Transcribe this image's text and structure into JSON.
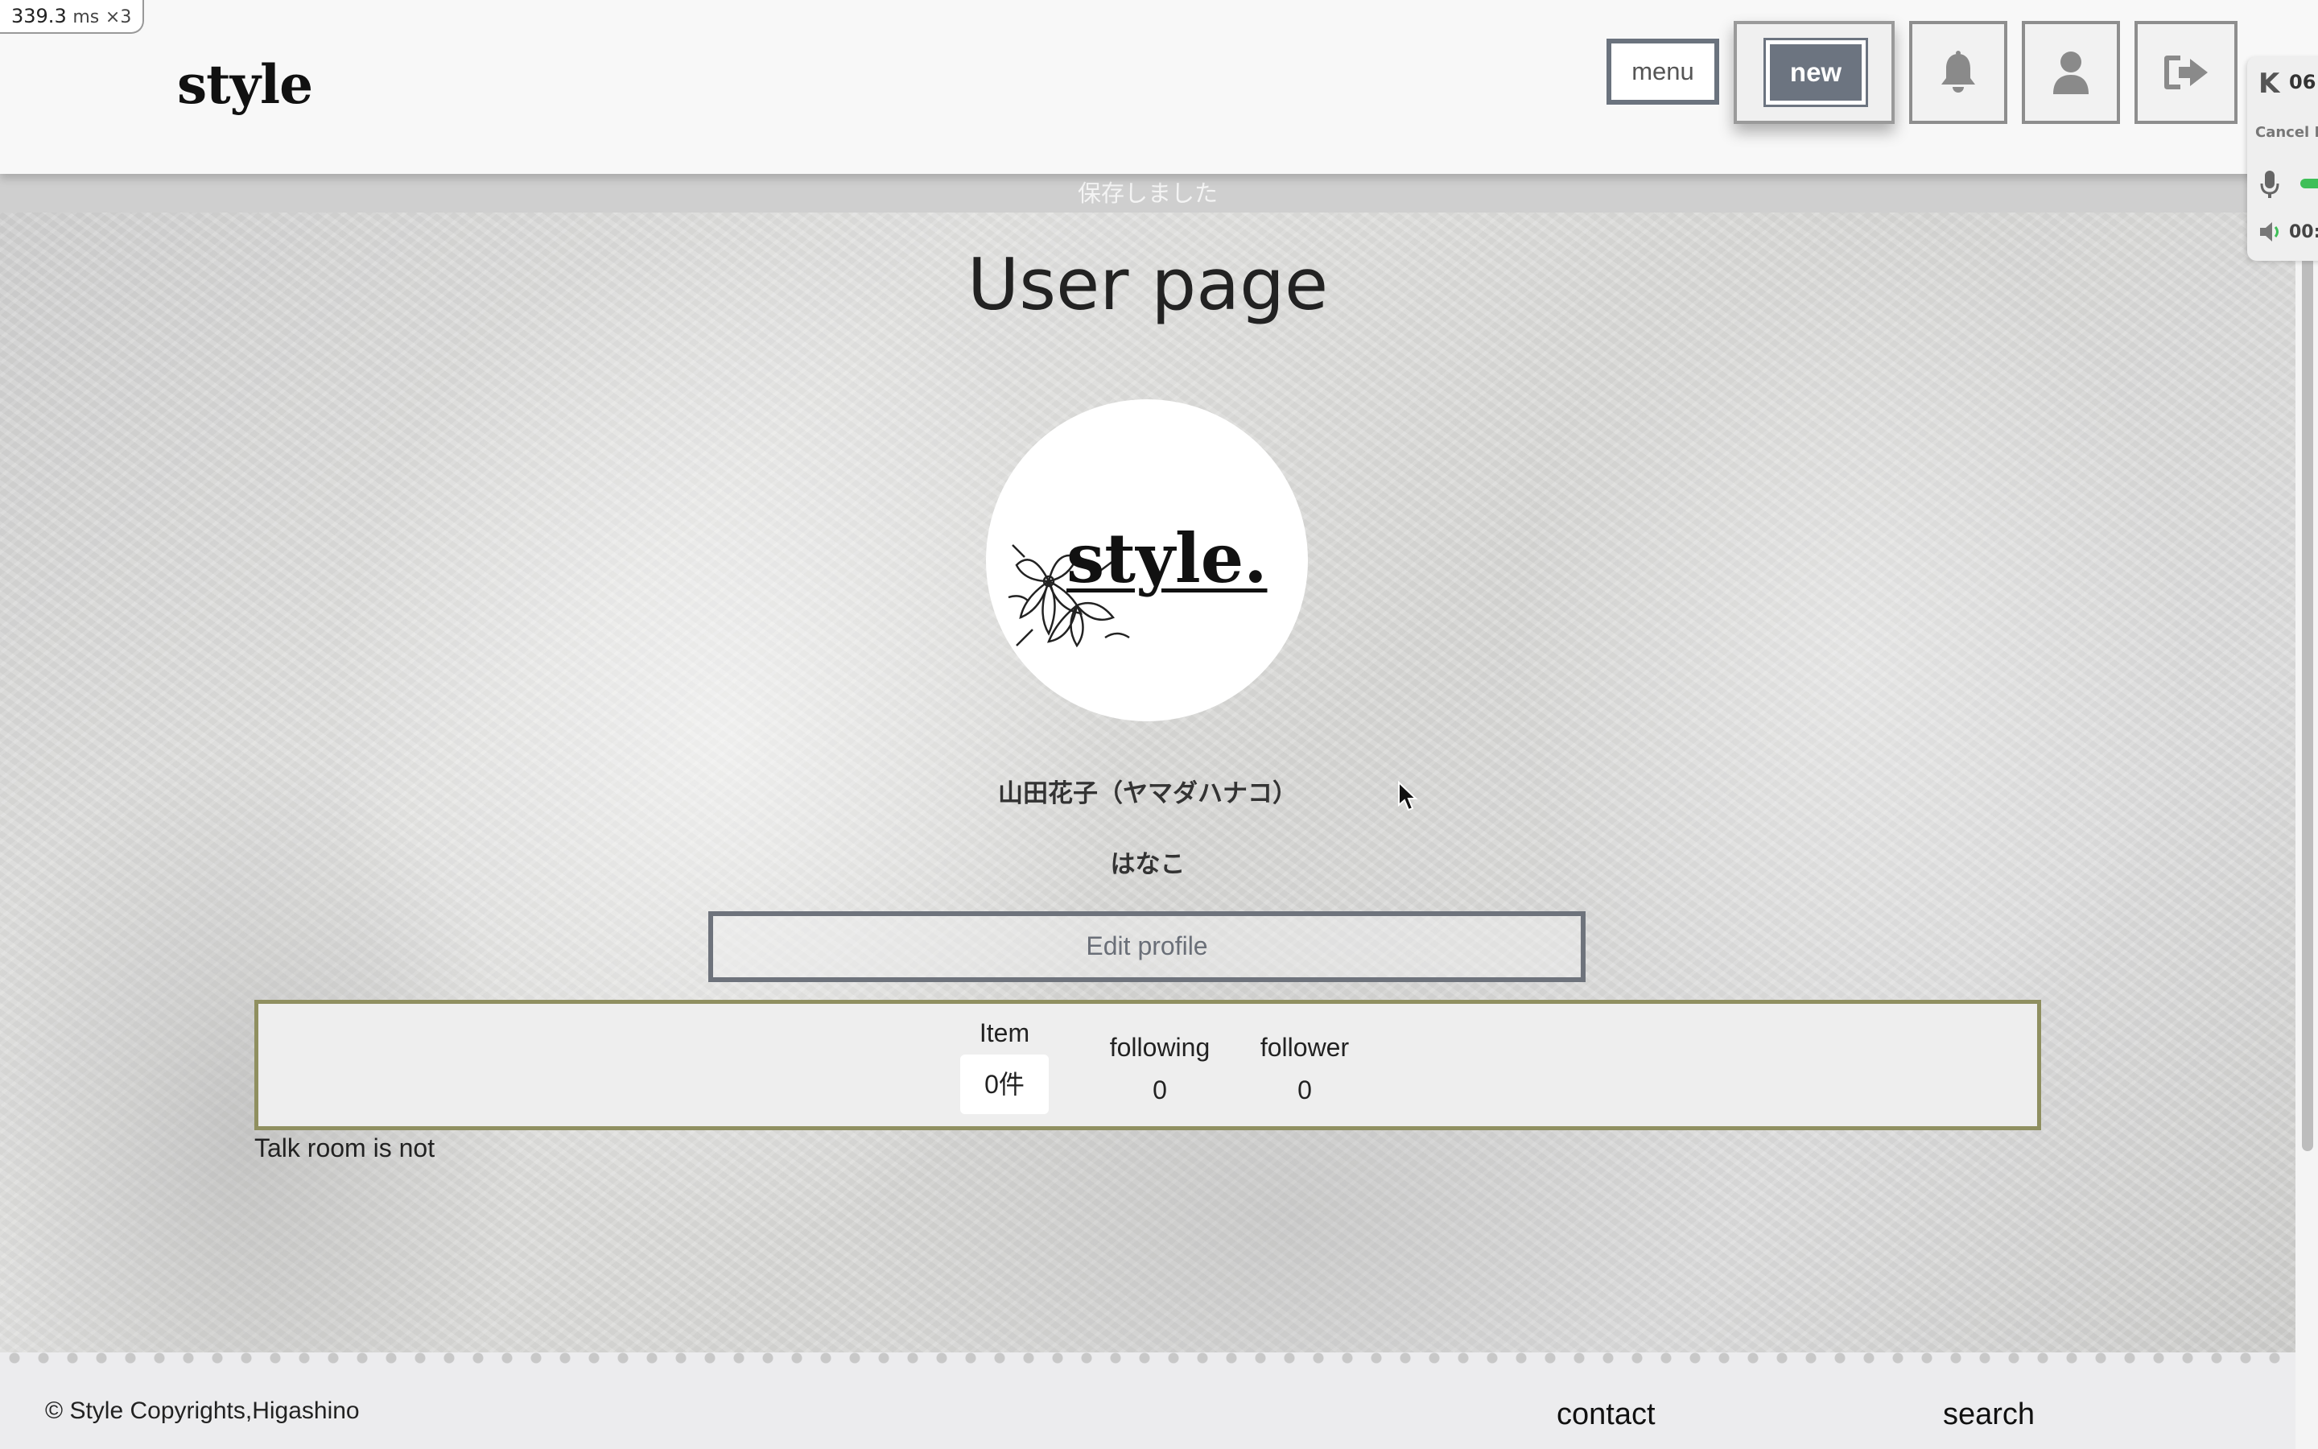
{
  "perf": {
    "value": "339.3",
    "unit": "ms",
    "multiplier": "×3"
  },
  "header": {
    "logo": "style",
    "menu_label": "menu",
    "new_label": "new",
    "icons": [
      "bell-icon",
      "user-icon",
      "sign-out-icon"
    ]
  },
  "side_panel": {
    "badge": "K",
    "time": "06:",
    "cancel": "Cancel I",
    "level_color": "#3fbf58",
    "time2": "00:"
  },
  "toast": "保存しました",
  "page": {
    "title": "User page",
    "avatar_text": "style.",
    "full_name": "山田花子（ヤマダハナコ）",
    "nickname": "はなこ",
    "edit_label": "Edit profile"
  },
  "stats": {
    "item_label": "Item",
    "item_value": "0件",
    "following_label": "following",
    "following_value": "0",
    "follower_label": "follower",
    "follower_value": "0"
  },
  "talk_room": "Talk room is not",
  "footer": {
    "copyright": "© Style Copyrights,Higashino",
    "contact": "contact",
    "search": "search"
  },
  "colors": {
    "button_gray": "#6c7480",
    "stats_border": "#8f8f60",
    "accent_green": "#3fbf58"
  }
}
